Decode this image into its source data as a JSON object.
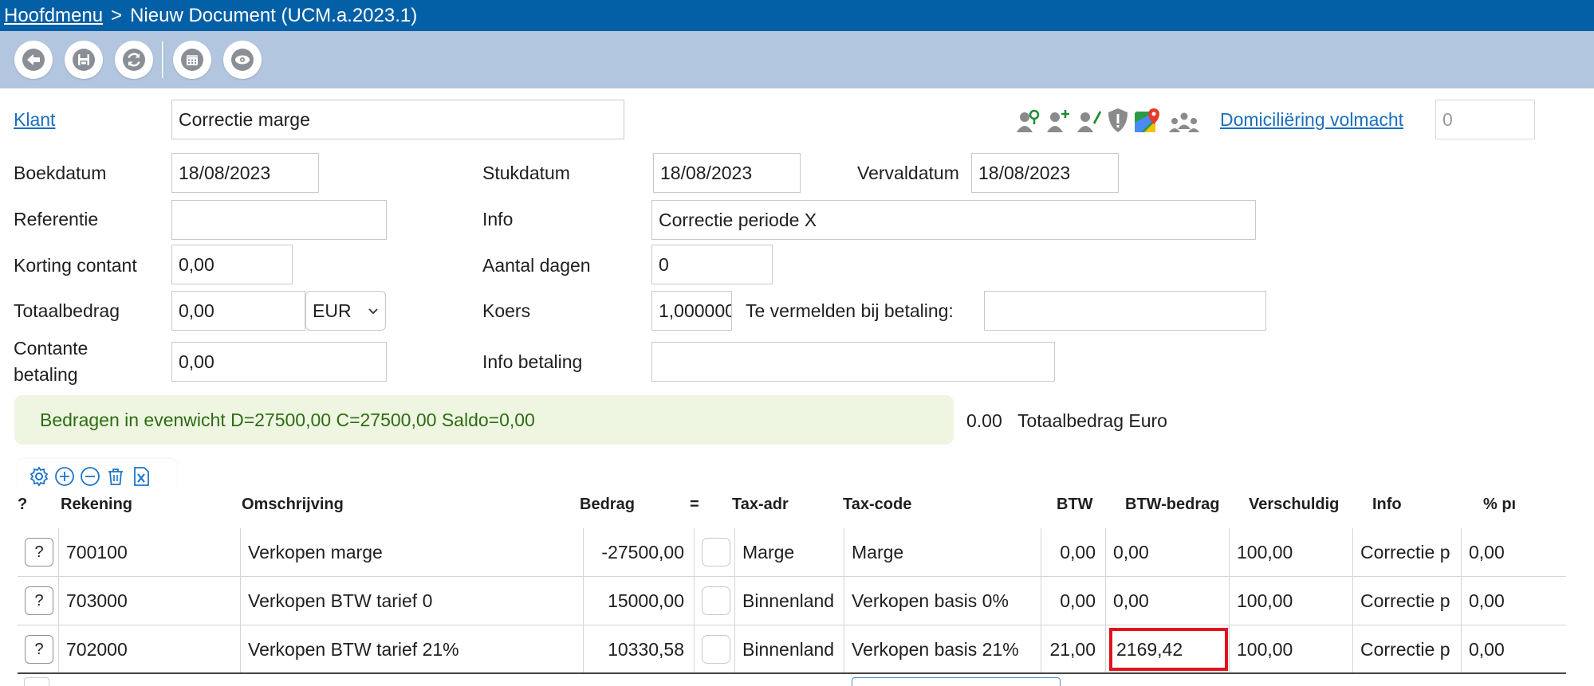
{
  "breadcrumb": {
    "home": "Hoofdmenu",
    "separator": ">",
    "current": "Nieuw Document (UCM.a.2023.1)"
  },
  "toolbar": {
    "icons": [
      "back-arrow-icon",
      "save-icon",
      "refresh-icon",
      "calendar-icon",
      "eye-icon"
    ]
  },
  "form": {
    "klant_label": "Klant",
    "klant_value": "Correctie marge",
    "client_icons": [
      "user-search-icon",
      "user-add-icon",
      "user-edit-icon",
      "shield-alert-icon",
      "google-maps-icon",
      "users-group-icon"
    ],
    "domiciliering_label": "Domiciliëring volmacht",
    "domiciliering_value": "0",
    "boekdatum_label": "Boekdatum",
    "boekdatum_value": "18/08/2023",
    "stukdatum_label": "Stukdatum",
    "stukdatum_value": "18/08/2023",
    "vervaldatum_label": "Vervaldatum",
    "vervaldatum_value": "18/08/2023",
    "referentie_label": "Referentie",
    "referentie_value": "",
    "info_label": "Info",
    "info_value": "Correctie periode X",
    "korting_label": "Korting contant",
    "korting_value": "0,00",
    "aantal_dagen_label": "Aantal dagen",
    "aantal_dagen_value": "0",
    "totaalbedrag_label": "Totaalbedrag",
    "totaalbedrag_value": "0,00",
    "currency_value": "EUR",
    "koers_label": "Koers",
    "koers_value": "1,000000",
    "te_vermelden_label": "Te vermelden bij betaling:",
    "te_vermelden_value": "",
    "contante_label_line1": "Contante",
    "contante_label_line2": "betaling",
    "contante_value": "0,00",
    "info_betaling_label": "Info betaling",
    "info_betaling_value": ""
  },
  "balance": {
    "message": "Bedragen in evenwicht D=27500,00 C=27500,00 Saldo=0,00",
    "total_value": "0.00",
    "total_label": "Totaalbedrag Euro"
  },
  "grid": {
    "tool_icons": [
      "settings-icon",
      "add-row-icon",
      "remove-row-icon",
      "delete-icon",
      "excel-export-icon"
    ],
    "headers": {
      "q": "?",
      "rekening": "Rekening",
      "omschrijving": "Omschrijving",
      "bedrag": "Bedrag",
      "eq": "=",
      "taxadr": "Tax-adr",
      "taxcode": "Tax-code",
      "btw": "BTW",
      "btwbedrag": "BTW-bedrag",
      "verschuldig": "Verschuldig",
      "info": "Info",
      "pct": "% pı"
    },
    "rows": [
      {
        "q": "?",
        "rekening": "700100",
        "omschrijving": "Verkopen marge",
        "bedrag": "-27500,00",
        "taxadr": "Marge",
        "taxcode": "Marge",
        "btw": "0,00",
        "btwbedrag": "0,00",
        "verschuldig": "100,00",
        "info": "Correctie p",
        "pct": "0,00"
      },
      {
        "q": "?",
        "rekening": "703000",
        "omschrijving": "Verkopen BTW tarief 0",
        "bedrag": "15000,00",
        "taxadr": "Binnenland",
        "taxcode": "Verkopen basis 0%",
        "btw": "0,00",
        "btwbedrag": "0,00",
        "verschuldig": "100,00",
        "info": "Correctie p",
        "pct": "0,00"
      },
      {
        "q": "?",
        "rekening": "702000",
        "omschrijving": "Verkopen BTW tarief 21%",
        "bedrag": "10330,58",
        "taxadr": "Binnenland",
        "taxcode": "Verkopen basis 21%",
        "btw": "21,00",
        "btwbedrag": "2169,42",
        "verschuldig": "100,00",
        "info": "Correctie p",
        "pct": "0,00"
      }
    ],
    "highlight_color": "#e0141c"
  },
  "colors": {
    "titlebar": "#0460a6",
    "toolbar": "#b3c6e0",
    "link": "#1a6fbf",
    "balance_bg": "#eef6e2",
    "balance_text": "#2f6b14"
  }
}
